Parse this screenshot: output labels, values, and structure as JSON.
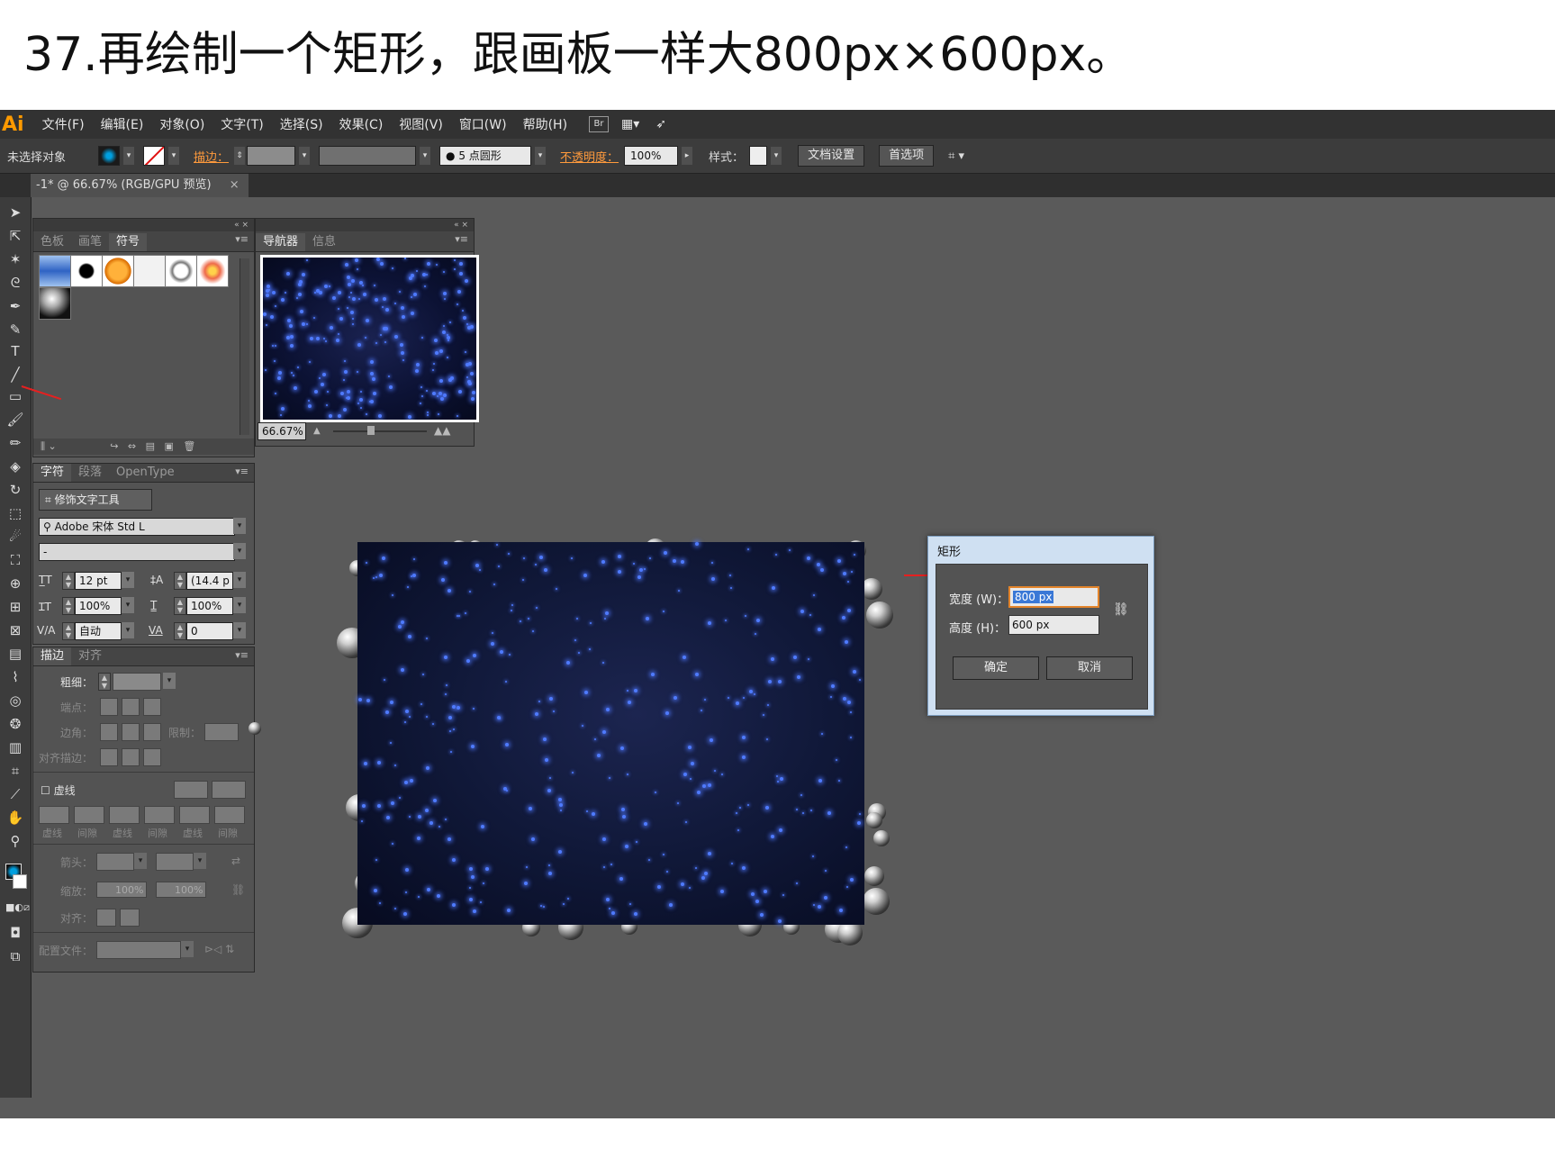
{
  "caption": "37.再绘制一个矩形，跟画板一样大800px×600px。",
  "app": {
    "logo": "Ai"
  },
  "menu": [
    "文件(F)",
    "编辑(E)",
    "对象(O)",
    "文字(T)",
    "选择(S)",
    "效果(C)",
    "视图(V)",
    "窗口(W)",
    "帮助(H)"
  ],
  "menu_icons": {
    "bridge": "Br",
    "workspace": "▦▾",
    "publish": "➶"
  },
  "control": {
    "no_selection": "未选择对象",
    "stroke_label": "描边：",
    "brush": "● 5 点圆形",
    "opacity_label": "不透明度：",
    "opacity_value": "100%",
    "style_label": "样式：",
    "doc_setup": "文档设置",
    "preferences": "首选项"
  },
  "doc_tab": {
    "title": "-1* @ 66.67% (RGB/GPU 预览)",
    "close": "×"
  },
  "swatches_panel": {
    "tabs": [
      "色板",
      "画笔",
      "符号"
    ],
    "active_tab": "符号"
  },
  "navigator_panel": {
    "tabs": [
      "导航器",
      "信息"
    ],
    "active_tab": "导航器",
    "zoom": "66.67%"
  },
  "character_panel": {
    "tabs": [
      "字符",
      "段落",
      "OpenType"
    ],
    "touch_tool": "修饰文字工具",
    "font_family": "Adobe 宋体 Std L",
    "font_style": "-",
    "font_size": "12 pt",
    "leading": "(14.4 p",
    "h_scale": "100%",
    "v_scale": "100%",
    "kerning": "自动",
    "tracking": "0"
  },
  "stroke_panel": {
    "tabs": [
      "描边",
      "对齐"
    ],
    "weight_label": "粗细：",
    "cap_label": "端点：",
    "corner_label": "边角：",
    "limit_label": "限制：",
    "align_label": "对齐描边：",
    "dashed_label": "虚线",
    "dash_labels": [
      "虚线",
      "间隙",
      "虚线",
      "间隙",
      "虚线",
      "间隙"
    ],
    "arrow_label": "箭头：",
    "scale_label": "缩放：",
    "scale_1": "100%",
    "scale_2": "100%",
    "align2_label": "对齐：",
    "profile_label": "配置文件："
  },
  "dialog": {
    "title": "矩形",
    "width_label": "宽度 (W)：",
    "width_value": "800 px",
    "height_label": "高度 (H)：",
    "height_value": "600 px",
    "ok": "确定",
    "cancel": "取消"
  },
  "colors": {
    "accent_orange": "#ff9a3c",
    "artboard": "#101838",
    "star": "#4f7bff",
    "dialog_frame": "#cfe0f2"
  }
}
